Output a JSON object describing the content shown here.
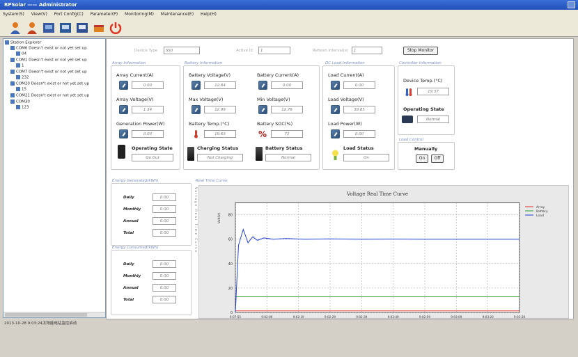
{
  "window": {
    "title": "RPSolar —— Administrator"
  },
  "menu": [
    "System(S)",
    "View(V)",
    "Port Config(C)",
    "Parameter(P)",
    "Monitoring(M)",
    "Maintenance(E)",
    "Help(H)"
  ],
  "toolbar_icons": [
    "user-icon",
    "user-manage-icon",
    "device-icon",
    "network-icon",
    "print-icon",
    "minimize-icon",
    "power-icon"
  ],
  "explorer": {
    "root": "Station Explorer",
    "items": [
      "COM6 Doesn't exist or not yet set up",
      "04",
      "COM1 Doesn't exist or not yet set up",
      "1",
      "COM7 Doesn't exist or not yet set up",
      "232",
      "COM20 Doesn't exist or not yet set up",
      "15",
      "COM21 Doesn't exist or not yet set up",
      "COM30",
      "123"
    ]
  },
  "status_bar": {
    "text": "2013-10-28 9:03:24太阳能电站监控启动"
  },
  "top_controls": {
    "device_type_label": "Device Type",
    "device_type_value": "SS0",
    "active_id_label": "Active ID",
    "active_id_value": "1",
    "refresh_interval_label": "Refresh Interval(s)",
    "refresh_interval_value": "1",
    "stop_monitor_label": "Stop Monitor"
  },
  "array_info": {
    "title": "Array Information",
    "current_label": "Array Current(A)",
    "current_value": "0.00",
    "voltage_label": "Array Voltage(V)",
    "voltage_value": "1.34",
    "power_label": "Generation Power(W)",
    "power_value": "0.00",
    "state_label": "Operating State",
    "state_value": "Go Out"
  },
  "battery_info": {
    "title": "Battery Information",
    "voltage_label": "Battery Voltage(V)",
    "voltage_value": "12.84",
    "current_label": "Battery Current(A)",
    "current_value": "0.00",
    "max_voltage_label": "Max Voltage(V)",
    "max_voltage_value": "12.99",
    "min_voltage_label": "Min Voltage(V)",
    "min_voltage_value": "12.76",
    "temp_label": "Battery Temp.(°C)",
    "temp_value": "19.63",
    "soc_label": "Battery SOC(%)",
    "soc_value": "72",
    "charging_label": "Charging Status",
    "charging_value": "Not Charging",
    "status_label": "Battery Status",
    "status_value": "Normal"
  },
  "load_info": {
    "title": "DC Load Information",
    "current_label": "Load Current(A)",
    "current_value": "0.00",
    "voltage_label": "Load Voltage(V)",
    "voltage_value": "39.85",
    "power_label": "Load Power(W)",
    "power_value": "0.00",
    "status_label": "Load Status",
    "status_value": "On"
  },
  "controller_info": {
    "title": "Controller Information",
    "temp_label": "Device Temp.(°C)",
    "temp_value": "19.37",
    "state_label": "Operating State",
    "state_value": "Normal"
  },
  "load_control": {
    "title": "Load Control",
    "mode_label": "Manually",
    "on_label": "On",
    "off_label": "Off"
  },
  "energy_generated": {
    "title": "Energy Generated(kWh)",
    "rows": [
      {
        "label": "Daily",
        "value": "0.00"
      },
      {
        "label": "Monthly",
        "value": "0.00"
      },
      {
        "label": "Annual",
        "value": "0.00"
      },
      {
        "label": "Total",
        "value": "0.00"
      }
    ]
  },
  "energy_consumed": {
    "title": "Energy Consumed(kWh)",
    "rows": [
      {
        "label": "Daily",
        "value": "0.00"
      },
      {
        "label": "Monthly",
        "value": "0.00"
      },
      {
        "label": "Annual",
        "value": "0.00"
      },
      {
        "label": "Total",
        "value": "0.00"
      }
    ]
  },
  "real_time": {
    "title": "Real Time Curve",
    "side_label": "Voltage Real Time Curve"
  },
  "chart_data": {
    "type": "line",
    "title": "Voltage Real Time Curve",
    "ylabel": "Volt(V)",
    "ylim": [
      0,
      90
    ],
    "yticks": [
      0,
      20,
      40,
      60,
      80
    ],
    "xticks": [
      "9:07:55",
      "9:02:09",
      "9:02:19",
      "9:02:29",
      "9:02:39",
      "9:02:49",
      "9:02:59",
      "9:03:09",
      "9:03:20",
      "9:03:28"
    ],
    "grid": true,
    "legend_position": "top-right",
    "colors": {
      "array": "#e0302a",
      "battery": "#2aa02a",
      "load": "#2040d8"
    },
    "series": [
      {
        "name": "Array",
        "x": [
          0,
          1,
          9
        ],
        "y": [
          1.3,
          1.3,
          1.3
        ]
      },
      {
        "name": "Battery",
        "x": [
          0,
          0.15,
          9
        ],
        "y": [
          12.8,
          12.8,
          12.8
        ]
      },
      {
        "name": "Load",
        "x": [
          0,
          0.1,
          0.25,
          0.4,
          0.55,
          0.7,
          0.9,
          1.2,
          1.6,
          2.2,
          3,
          4,
          5,
          6,
          7,
          8,
          9
        ],
        "y": [
          0,
          55,
          68,
          57,
          62,
          59,
          61,
          60,
          60.5,
          60,
          60.2,
          60,
          60.1,
          60,
          60,
          60,
          60
        ]
      }
    ]
  }
}
